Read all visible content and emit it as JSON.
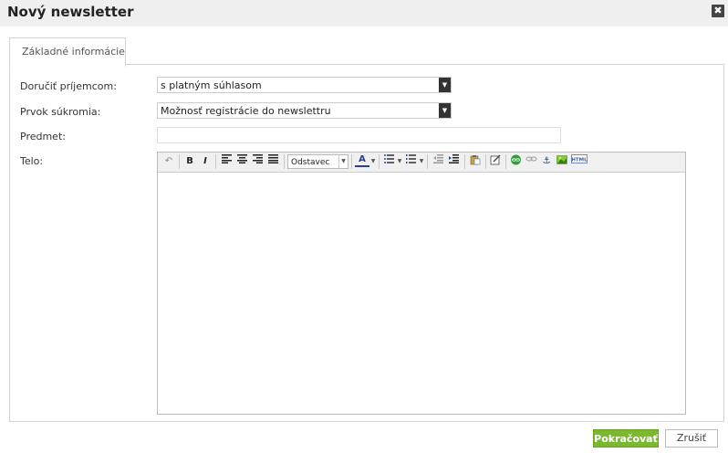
{
  "dialog": {
    "title": "Nový newsletter",
    "close_glyph": "✖"
  },
  "tabs": [
    {
      "label": "Základné informácie"
    }
  ],
  "form": {
    "recipients": {
      "label": "Doručiť príjemcom:",
      "value": "s platným súhlasom"
    },
    "privacy": {
      "label": "Prvok súkromia:",
      "value": "Možnosť registrácie do newslettru"
    },
    "subject": {
      "label": "Predmet:",
      "value": ""
    },
    "body": {
      "label": "Telo:"
    }
  },
  "editor": {
    "format_value": "Odstavec",
    "bold": "B",
    "italic": "I",
    "icons": [
      "undo-icon",
      "bold-icon",
      "italic-icon",
      "align-left-icon",
      "align-center-icon",
      "align-right-icon",
      "align-justify-icon",
      "text-color-icon",
      "bullet-list-icon",
      "numbered-list-icon",
      "outdent-icon",
      "indent-icon",
      "paste-icon",
      "edit-icon",
      "link-icon",
      "unlink-icon",
      "anchor-icon",
      "image-icon",
      "html-icon"
    ]
  },
  "buttons": {
    "continue": "Pokračovať",
    "cancel": "Zrušiť"
  },
  "colors": {
    "primary": "#7cb82f",
    "panel_border": "#d3d3d3"
  }
}
